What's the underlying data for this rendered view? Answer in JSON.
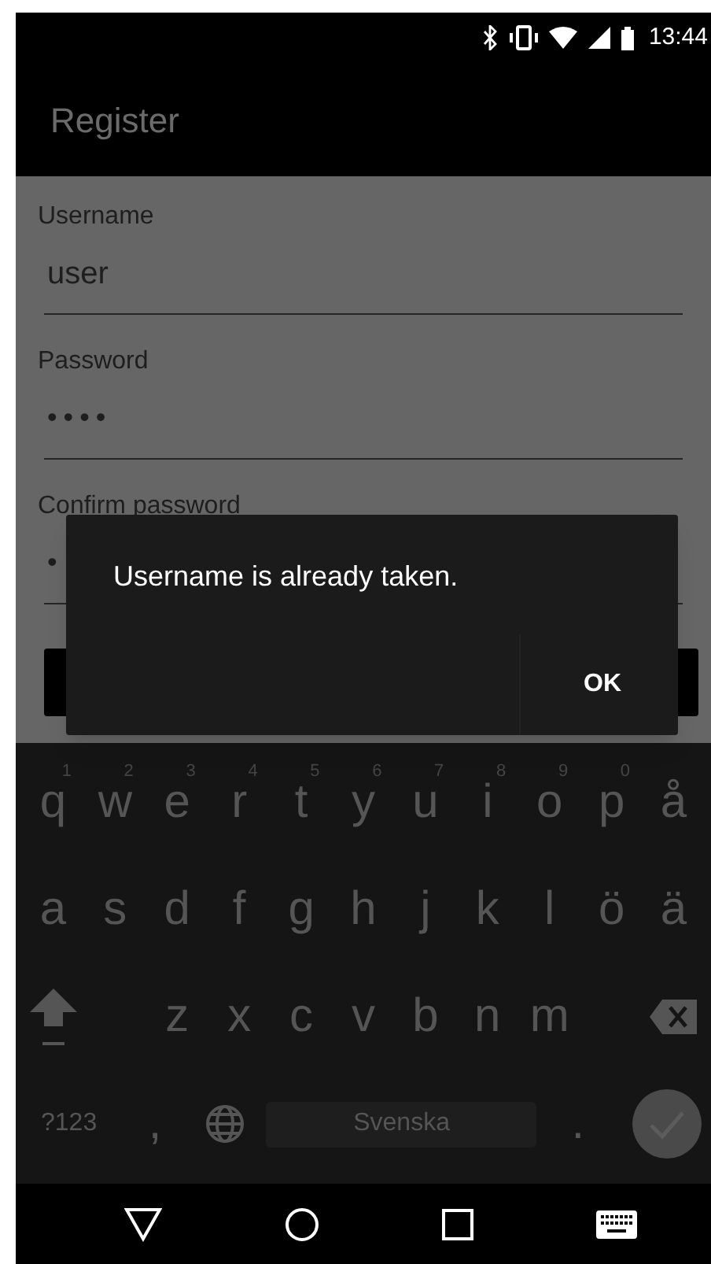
{
  "status_bar": {
    "time": "13:44"
  },
  "app_bar": {
    "title": "Register"
  },
  "form": {
    "fields": [
      {
        "label": "Username",
        "value": "user",
        "kind": "text"
      },
      {
        "label": "Password",
        "value": "••••",
        "kind": "password"
      },
      {
        "label": "Confirm password",
        "value": "•",
        "kind": "password"
      }
    ]
  },
  "dialog": {
    "message": "Username is already taken.",
    "buttons": [
      "OK"
    ]
  },
  "keyboard": {
    "rows": [
      [
        {
          "kind": "letter",
          "label": "q",
          "hint": "1"
        },
        {
          "kind": "letter",
          "label": "w",
          "hint": "2"
        },
        {
          "kind": "letter",
          "label": "e",
          "hint": "3"
        },
        {
          "kind": "letter",
          "label": "r",
          "hint": "4"
        },
        {
          "kind": "letter",
          "label": "t",
          "hint": "5"
        },
        {
          "kind": "letter",
          "label": "y",
          "hint": "6"
        },
        {
          "kind": "letter",
          "label": "u",
          "hint": "7"
        },
        {
          "kind": "letter",
          "label": "i",
          "hint": "8"
        },
        {
          "kind": "letter",
          "label": "o",
          "hint": "9"
        },
        {
          "kind": "letter",
          "label": "p",
          "hint": "0"
        },
        {
          "kind": "letter",
          "label": "å"
        }
      ],
      [
        {
          "kind": "letter",
          "label": "a"
        },
        {
          "kind": "letter",
          "label": "s"
        },
        {
          "kind": "letter",
          "label": "d"
        },
        {
          "kind": "letter",
          "label": "f"
        },
        {
          "kind": "letter",
          "label": "g"
        },
        {
          "kind": "letter",
          "label": "h"
        },
        {
          "kind": "letter",
          "label": "j"
        },
        {
          "kind": "letter",
          "label": "k"
        },
        {
          "kind": "letter",
          "label": "l"
        },
        {
          "kind": "letter",
          "label": "ö"
        },
        {
          "kind": "letter",
          "label": "ä"
        }
      ],
      [
        {
          "kind": "shift"
        },
        {
          "kind": "gap"
        },
        {
          "kind": "letter",
          "label": "z"
        },
        {
          "kind": "letter",
          "label": "x"
        },
        {
          "kind": "letter",
          "label": "c"
        },
        {
          "kind": "letter",
          "label": "v"
        },
        {
          "kind": "letter",
          "label": "b"
        },
        {
          "kind": "letter",
          "label": "n"
        },
        {
          "kind": "letter",
          "label": "m"
        },
        {
          "kind": "gap"
        },
        {
          "kind": "backspace"
        }
      ]
    ],
    "bottom_row": [
      {
        "kind": "symbols",
        "label": "?123"
      },
      {
        "kind": "letter",
        "label": ","
      },
      {
        "kind": "globe"
      },
      {
        "kind": "space",
        "label": "Svenska"
      },
      {
        "kind": "letter",
        "label": "."
      },
      {
        "kind": "enter"
      }
    ]
  }
}
